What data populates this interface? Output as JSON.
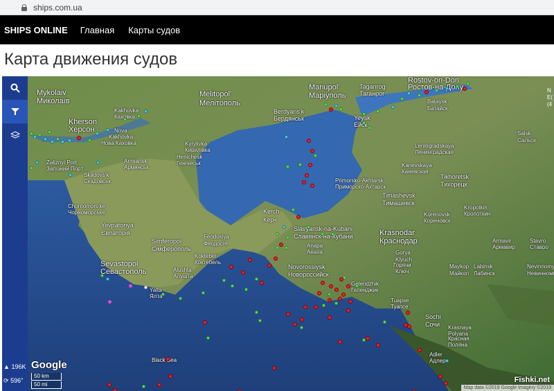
{
  "browser": {
    "url": "ships.com.ua"
  },
  "nav": {
    "brand": "SHIPS ONLINE",
    "links": [
      "Главная",
      "Карты судов"
    ]
  },
  "page": {
    "title": "Карта движения судов"
  },
  "sidebar": {
    "vessels_count": "196K",
    "refresh": "596\""
  },
  "map": {
    "google_logo": "Google",
    "scale": [
      "50 km",
      "50 mi"
    ],
    "attribution": "Map data ©2019 Google Imagery ©2019",
    "watermark": "Fishki.net",
    "edge_text": [
      "N",
      "E(",
      "(4"
    ],
    "places": [
      {
        "t": "Mykolaiv",
        "c": "big"
      },
      {
        "t": "Миколаїв",
        "c": "big"
      },
      {
        "t": "Kherson",
        "c": "big"
      },
      {
        "t": "Херсон",
        "c": "big"
      },
      {
        "t": "Kakhovka",
        "c": ""
      },
      {
        "t": "Каховка",
        "c": ""
      },
      {
        "t": "Nova",
        "c": ""
      },
      {
        "t": "Kakhovka",
        "c": ""
      },
      {
        "t": "Нова Каховка",
        "c": ""
      },
      {
        "t": "Melitopol'",
        "c": "big"
      },
      {
        "t": "Мелітополь",
        "c": "big"
      },
      {
        "t": "Berdyans'k",
        "c": "mid"
      },
      {
        "t": "Бердянськ",
        "c": "mid"
      },
      {
        "t": "Mariupol'",
        "c": "big"
      },
      {
        "t": "Маріуполь",
        "c": "big"
      },
      {
        "t": "Taganrog",
        "c": "mid"
      },
      {
        "t": "Таганрог",
        "c": "mid"
      },
      {
        "t": "Rostov-on-Don",
        "c": "big"
      },
      {
        "t": "Ростов-на-Дону",
        "c": "big"
      },
      {
        "t": "Bataysk",
        "c": ""
      },
      {
        "t": "Батайск",
        "c": ""
      },
      {
        "t": "Yeysk",
        "c": "mid"
      },
      {
        "t": "Ейск",
        "c": "mid"
      },
      {
        "t": "Salsk",
        "c": ""
      },
      {
        "t": "Сальск",
        "c": ""
      },
      {
        "t": "Zaliznyi Port",
        "c": ""
      },
      {
        "t": "Залізний Порт",
        "c": ""
      },
      {
        "t": "Armiansk",
        "c": ""
      },
      {
        "t": "Армянськ",
        "c": ""
      },
      {
        "t": "Henichesk",
        "c": ""
      },
      {
        "t": "Генічеськ",
        "c": ""
      },
      {
        "t": "Kyrylivka",
        "c": ""
      },
      {
        "t": "Кирилівка",
        "c": ""
      },
      {
        "t": "Skadovs'k",
        "c": ""
      },
      {
        "t": "Скадовськ",
        "c": ""
      },
      {
        "t": "Leningradskaya",
        "c": ""
      },
      {
        "t": "Ленинградская",
        "c": ""
      },
      {
        "t": "Kanevskaya",
        "c": ""
      },
      {
        "t": "Каневская",
        "c": ""
      },
      {
        "t": "Tikhoretsk",
        "c": "mid"
      },
      {
        "t": "Тихорецк",
        "c": "mid"
      },
      {
        "t": "Primorsko-Akhtarsk",
        "c": ""
      },
      {
        "t": "Приморско-Ахтарск",
        "c": ""
      },
      {
        "t": "Timashevsk",
        "c": "mid"
      },
      {
        "t": "Тимашевск",
        "c": "mid"
      },
      {
        "t": "Chornomors'ke",
        "c": ""
      },
      {
        "t": "Чорноморське",
        "c": ""
      },
      {
        "t": "Kerch",
        "c": "mid"
      },
      {
        "t": "Керч",
        "c": "mid"
      },
      {
        "t": "Yevpatoriya",
        "c": "mid"
      },
      {
        "t": "Євпаторія",
        "c": "mid"
      },
      {
        "t": "Simferopol",
        "c": "mid"
      },
      {
        "t": "Сімферополь",
        "c": "mid"
      },
      {
        "t": "Feodosiya",
        "c": ""
      },
      {
        "t": "Феодосія",
        "c": ""
      },
      {
        "t": "Slavyansk-na-Kubani",
        "c": "mid"
      },
      {
        "t": "Славянск-на-Кубани",
        "c": "mid"
      },
      {
        "t": "Korenovsk",
        "c": ""
      },
      {
        "t": "Кореновск",
        "c": ""
      },
      {
        "t": "Kropotkin",
        "c": ""
      },
      {
        "t": "Кропоткин",
        "c": ""
      },
      {
        "t": "Krasnodar",
        "c": "big"
      },
      {
        "t": "Краснодар",
        "c": "big"
      },
      {
        "t": "Armavir",
        "c": ""
      },
      {
        "t": "Армавир",
        "c": ""
      },
      {
        "t": "Stavro",
        "c": ""
      },
      {
        "t": "Ставро",
        "c": ""
      },
      {
        "t": "Anapa",
        "c": ""
      },
      {
        "t": "Анапа",
        "c": ""
      },
      {
        "t": "Gorya",
        "c": ""
      },
      {
        "t": "Klyuch",
        "c": ""
      },
      {
        "t": "Горячи",
        "c": ""
      },
      {
        "t": "Ключ",
        "c": ""
      },
      {
        "t": "Koktebel",
        "c": ""
      },
      {
        "t": "Коктебель",
        "c": ""
      },
      {
        "t": "Sevastopol",
        "c": "big"
      },
      {
        "t": "Севастополь",
        "c": "big"
      },
      {
        "t": "Alushta",
        "c": ""
      },
      {
        "t": "Алушта",
        "c": ""
      },
      {
        "t": "Yalta",
        "c": ""
      },
      {
        "t": "Ялта",
        "c": ""
      },
      {
        "t": "Novorossiysk",
        "c": "mid"
      },
      {
        "t": "Новороссийск",
        "c": "mid"
      },
      {
        "t": "Gelendzhik",
        "c": ""
      },
      {
        "t": "Геленджик",
        "c": ""
      },
      {
        "t": "Maykop",
        "c": ""
      },
      {
        "t": "Майкоп",
        "c": ""
      },
      {
        "t": "Labinsk",
        "c": ""
      },
      {
        "t": "Лабинск",
        "c": ""
      },
      {
        "t": "Nevinnomy",
        "c": ""
      },
      {
        "t": "Невинномы",
        "c": ""
      },
      {
        "t": "Tuapse",
        "c": ""
      },
      {
        "t": "Туапсе",
        "c": ""
      },
      {
        "t": "Sochi",
        "c": "mid"
      },
      {
        "t": "Сочи",
        "c": "mid"
      },
      {
        "t": "Krasnaya",
        "c": ""
      },
      {
        "t": "Polyana",
        "c": ""
      },
      {
        "t": "Красная",
        "c": ""
      },
      {
        "t": "Поляна",
        "c": ""
      },
      {
        "t": "Adler",
        "c": ""
      },
      {
        "t": "Адлер",
        "c": ""
      },
      {
        "t": "Black Sea",
        "c": ""
      }
    ],
    "ship_colors": {
      "green": "#5ee05a",
      "red": "#e8202a",
      "cyan": "#4ad7e8",
      "pink": "#e54ad6"
    }
  }
}
